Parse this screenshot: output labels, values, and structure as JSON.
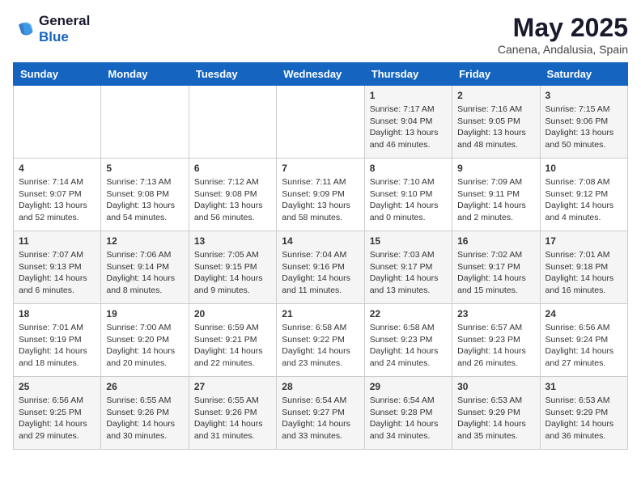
{
  "header": {
    "logo_line1": "General",
    "logo_line2": "Blue",
    "month": "May 2025",
    "location": "Canena, Andalusia, Spain"
  },
  "weekdays": [
    "Sunday",
    "Monday",
    "Tuesday",
    "Wednesday",
    "Thursday",
    "Friday",
    "Saturday"
  ],
  "weeks": [
    [
      {
        "day": "",
        "info": ""
      },
      {
        "day": "",
        "info": ""
      },
      {
        "day": "",
        "info": ""
      },
      {
        "day": "",
        "info": ""
      },
      {
        "day": "1",
        "info": "Sunrise: 7:17 AM\nSunset: 9:04 PM\nDaylight: 13 hours\nand 46 minutes."
      },
      {
        "day": "2",
        "info": "Sunrise: 7:16 AM\nSunset: 9:05 PM\nDaylight: 13 hours\nand 48 minutes."
      },
      {
        "day": "3",
        "info": "Sunrise: 7:15 AM\nSunset: 9:06 PM\nDaylight: 13 hours\nand 50 minutes."
      }
    ],
    [
      {
        "day": "4",
        "info": "Sunrise: 7:14 AM\nSunset: 9:07 PM\nDaylight: 13 hours\nand 52 minutes."
      },
      {
        "day": "5",
        "info": "Sunrise: 7:13 AM\nSunset: 9:08 PM\nDaylight: 13 hours\nand 54 minutes."
      },
      {
        "day": "6",
        "info": "Sunrise: 7:12 AM\nSunset: 9:08 PM\nDaylight: 13 hours\nand 56 minutes."
      },
      {
        "day": "7",
        "info": "Sunrise: 7:11 AM\nSunset: 9:09 PM\nDaylight: 13 hours\nand 58 minutes."
      },
      {
        "day": "8",
        "info": "Sunrise: 7:10 AM\nSunset: 9:10 PM\nDaylight: 14 hours\nand 0 minutes."
      },
      {
        "day": "9",
        "info": "Sunrise: 7:09 AM\nSunset: 9:11 PM\nDaylight: 14 hours\nand 2 minutes."
      },
      {
        "day": "10",
        "info": "Sunrise: 7:08 AM\nSunset: 9:12 PM\nDaylight: 14 hours\nand 4 minutes."
      }
    ],
    [
      {
        "day": "11",
        "info": "Sunrise: 7:07 AM\nSunset: 9:13 PM\nDaylight: 14 hours\nand 6 minutes."
      },
      {
        "day": "12",
        "info": "Sunrise: 7:06 AM\nSunset: 9:14 PM\nDaylight: 14 hours\nand 8 minutes."
      },
      {
        "day": "13",
        "info": "Sunrise: 7:05 AM\nSunset: 9:15 PM\nDaylight: 14 hours\nand 9 minutes."
      },
      {
        "day": "14",
        "info": "Sunrise: 7:04 AM\nSunset: 9:16 PM\nDaylight: 14 hours\nand 11 minutes."
      },
      {
        "day": "15",
        "info": "Sunrise: 7:03 AM\nSunset: 9:17 PM\nDaylight: 14 hours\nand 13 minutes."
      },
      {
        "day": "16",
        "info": "Sunrise: 7:02 AM\nSunset: 9:17 PM\nDaylight: 14 hours\nand 15 minutes."
      },
      {
        "day": "17",
        "info": "Sunrise: 7:01 AM\nSunset: 9:18 PM\nDaylight: 14 hours\nand 16 minutes."
      }
    ],
    [
      {
        "day": "18",
        "info": "Sunrise: 7:01 AM\nSunset: 9:19 PM\nDaylight: 14 hours\nand 18 minutes."
      },
      {
        "day": "19",
        "info": "Sunrise: 7:00 AM\nSunset: 9:20 PM\nDaylight: 14 hours\nand 20 minutes."
      },
      {
        "day": "20",
        "info": "Sunrise: 6:59 AM\nSunset: 9:21 PM\nDaylight: 14 hours\nand 22 minutes."
      },
      {
        "day": "21",
        "info": "Sunrise: 6:58 AM\nSunset: 9:22 PM\nDaylight: 14 hours\nand 23 minutes."
      },
      {
        "day": "22",
        "info": "Sunrise: 6:58 AM\nSunset: 9:23 PM\nDaylight: 14 hours\nand 24 minutes."
      },
      {
        "day": "23",
        "info": "Sunrise: 6:57 AM\nSunset: 9:23 PM\nDaylight: 14 hours\nand 26 minutes."
      },
      {
        "day": "24",
        "info": "Sunrise: 6:56 AM\nSunset: 9:24 PM\nDaylight: 14 hours\nand 27 minutes."
      }
    ],
    [
      {
        "day": "25",
        "info": "Sunrise: 6:56 AM\nSunset: 9:25 PM\nDaylight: 14 hours\nand 29 minutes."
      },
      {
        "day": "26",
        "info": "Sunrise: 6:55 AM\nSunset: 9:26 PM\nDaylight: 14 hours\nand 30 minutes."
      },
      {
        "day": "27",
        "info": "Sunrise: 6:55 AM\nSunset: 9:26 PM\nDaylight: 14 hours\nand 31 minutes."
      },
      {
        "day": "28",
        "info": "Sunrise: 6:54 AM\nSunset: 9:27 PM\nDaylight: 14 hours\nand 33 minutes."
      },
      {
        "day": "29",
        "info": "Sunrise: 6:54 AM\nSunset: 9:28 PM\nDaylight: 14 hours\nand 34 minutes."
      },
      {
        "day": "30",
        "info": "Sunrise: 6:53 AM\nSunset: 9:29 PM\nDaylight: 14 hours\nand 35 minutes."
      },
      {
        "day": "31",
        "info": "Sunrise: 6:53 AM\nSunset: 9:29 PM\nDaylight: 14 hours\nand 36 minutes."
      }
    ]
  ]
}
